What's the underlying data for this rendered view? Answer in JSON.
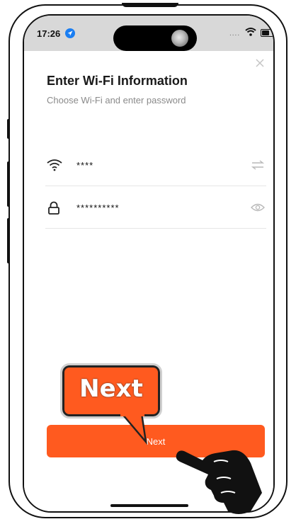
{
  "status_bar": {
    "time": "17:26",
    "signal": "...."
  },
  "dialog": {
    "title": "Enter Wi-Fi Information",
    "subtitle": "Choose Wi-Fi and enter password",
    "wifi_field": {
      "icon": "wifi-icon",
      "value": "****",
      "action_icon": "switch-network-icon"
    },
    "password_field": {
      "icon": "lock-icon",
      "value": "**********",
      "action_icon": "eye-icon"
    },
    "next_label": "Next"
  },
  "annotation": {
    "callout_label": "Next",
    "pointer_icon": "hand-pointer-icon"
  },
  "colors": {
    "accent": "#ff5a1f",
    "status_bar_bg": "#d8d8d8",
    "location_blue": "#1a7ef2"
  }
}
